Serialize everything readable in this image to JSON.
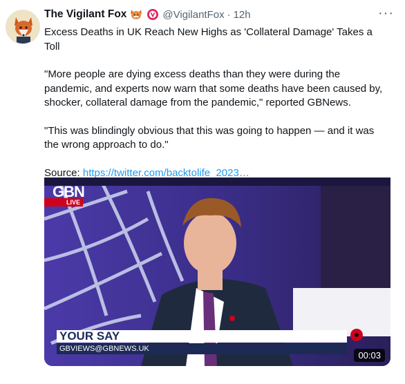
{
  "tweet": {
    "author_name": "The Vigilant Fox",
    "handle": "@VigilantFox",
    "separator": "·",
    "time": "12h",
    "more_label": "···",
    "paragraphs": [
      "Excess Deaths in UK Reach New Highs as 'Collateral Damage' Takes a Toll",
      "\"More people are dying excess deaths than they were during the pandemic, and experts now warn that some deaths have been caused by, shocker, collateral damage from the pandemic,\" reported GBNews.",
      "\"This was blindingly obvious that this was going to happen — and it was the wrong approach to do.\""
    ],
    "source_label": "Source: ",
    "source_link": "https://twitter.com/backtolife_2023…"
  },
  "video": {
    "logo_text": "GBN",
    "live_label": "LIVE",
    "lower_third_title": "YOUR SAY",
    "lower_third_subtitle": "GBVIEWS@GBNEWS.UK",
    "duration": "00:03",
    "colors": {
      "backdrop": "#3a2a7a",
      "live_red": "#d0021b",
      "lower_third_navy": "#1d2a55"
    }
  },
  "icons": {
    "avatar": "fox-avatar",
    "emoji": "fox-face-icon",
    "verified": "verified-badge-icon"
  }
}
